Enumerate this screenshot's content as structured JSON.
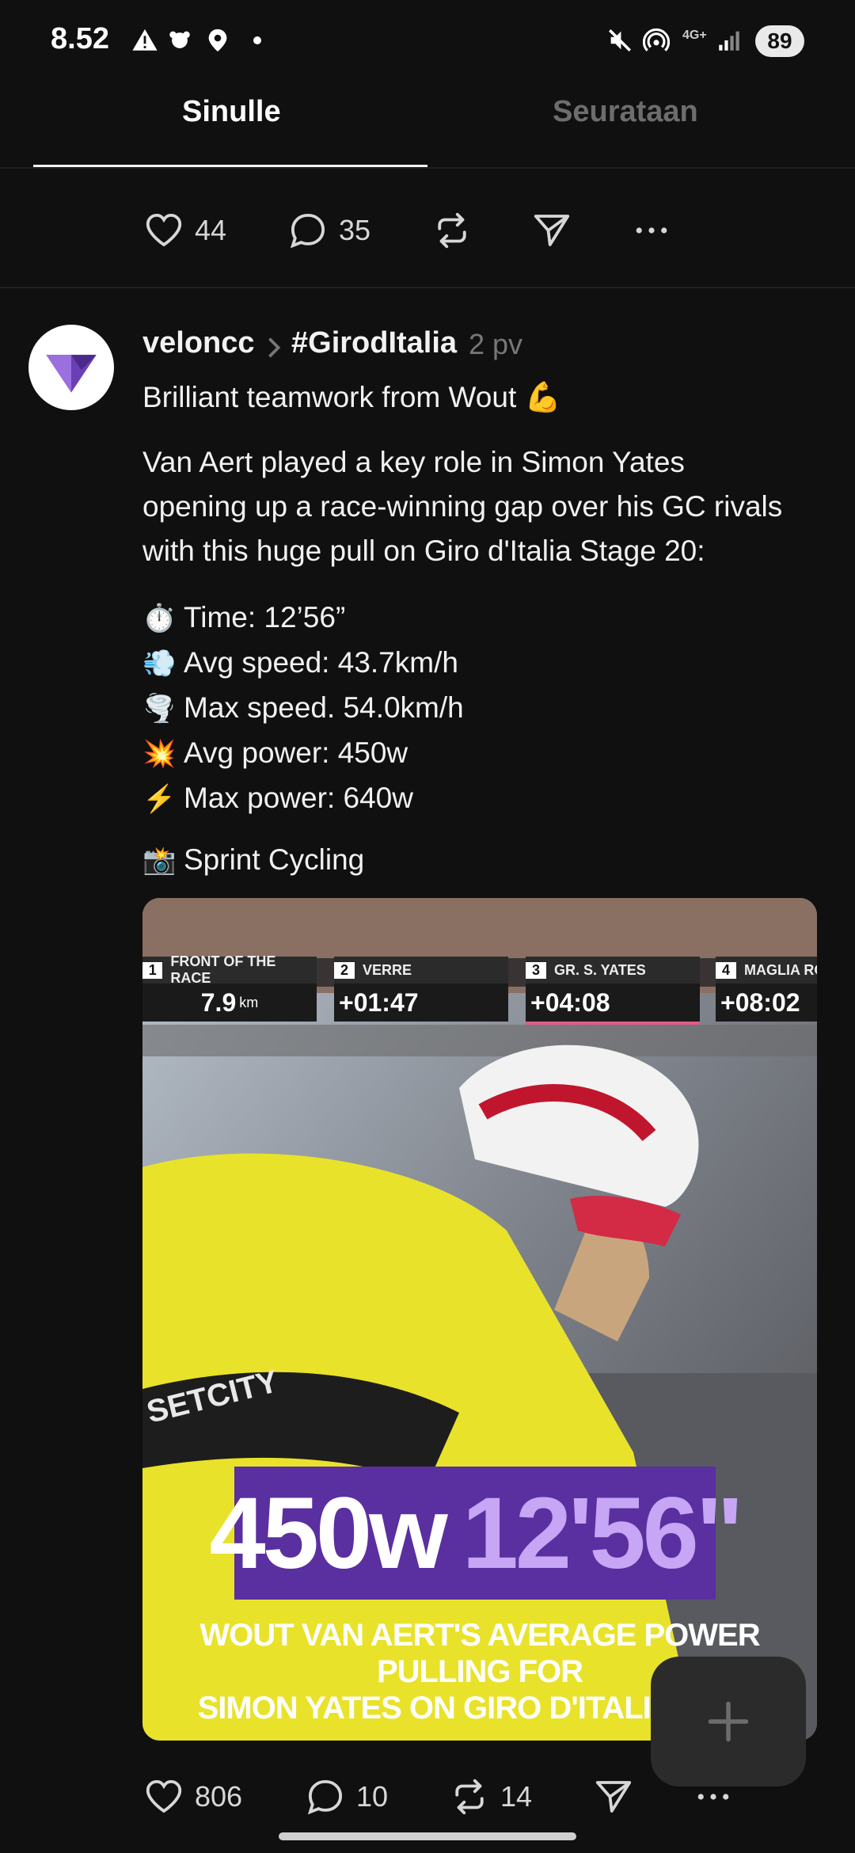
{
  "status": {
    "time": "8.52",
    "battery": "89",
    "network": "4G+"
  },
  "tabs": {
    "active": "Sinulle",
    "inactive": "Seurataan"
  },
  "prev_post": {
    "likes": "44",
    "replies": "35"
  },
  "post": {
    "username": "veloncc",
    "tag": "#GirodItalia",
    "time_ago": "2 pv",
    "line1": "Brilliant teamwork from Wout 💪",
    "body_lines": [
      "Van Aert played a key role in Simon Yates",
      "opening up a race-winning gap over his GC rivals",
      "with this huge pull on Giro d'Italia Stage 20:"
    ],
    "stats": [
      {
        "emoji": "⏱️",
        "text": "Time: 12’56”"
      },
      {
        "emoji": "💨",
        "text": "Avg speed: 43.7km/h"
      },
      {
        "emoji": "🌪️",
        "text": "Max speed. 54.0km/h"
      },
      {
        "emoji": "💥",
        "text": "Avg power: 450w"
      },
      {
        "emoji": "⚡",
        "text": "Max power: 640w"
      }
    ],
    "credit": {
      "emoji": "📸",
      "text": "Sprint Cycling"
    },
    "image": {
      "overlay_cells": [
        {
          "n": "1",
          "label": "FRONT OF THE RACE",
          "value": "7.9",
          "unit": "km"
        },
        {
          "n": "2",
          "label": "VERRE",
          "value": "+01:47"
        },
        {
          "n": "3",
          "label": "GR. S. YATES",
          "value": "+04:08"
        },
        {
          "n": "4",
          "label": "MAGLIA RO",
          "value": "+08:02"
        }
      ],
      "big_power": "450w",
      "big_time": "12'56\"",
      "caption_line1": "WOUT VAN AERT'S AVERAGE POWER PULLING FOR",
      "caption_line2": "SIMON YATES ON GIRO D'ITALIA STAG",
      "jersey_text": "SETCITY"
    },
    "likes": "806",
    "replies": "10",
    "reposts": "14"
  }
}
